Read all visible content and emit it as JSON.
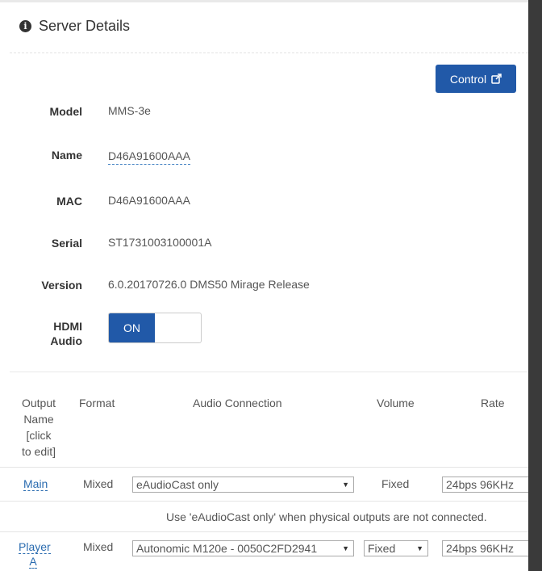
{
  "dialog": {
    "title": "Server Details",
    "control_label": "Control"
  },
  "details": {
    "model_label": "Model",
    "model_value": "MMS-3e",
    "name_label": "Name",
    "name_value": "D46A91600AAA",
    "mac_label": "MAC",
    "mac_value": "D46A91600AAA",
    "serial_label": "Serial",
    "serial_value": "ST1731003100001A",
    "version_label": "Version",
    "version_value": "6.0.20170726.0 DMS50 Mirage Release",
    "hdmi_label_line1": "HDMI",
    "hdmi_label_line2": "Audio",
    "hdmi_toggle": "ON"
  },
  "table": {
    "headers": {
      "output_name": [
        "Output",
        "Name",
        "[click",
        "to edit]"
      ],
      "format": "Format",
      "audio_connection": "Audio Connection",
      "volume": "Volume",
      "rate": "Rate"
    },
    "rows": [
      {
        "name": "Main",
        "format": "Mixed",
        "audio_connection": "eAudioCast only",
        "volume": "Fixed",
        "rate": "24bps 96KHz"
      },
      {
        "name_line1": "Player",
        "name_line2": "A",
        "format": "Mixed",
        "audio_connection": "Autonomic M120e - 0050C2FD2941",
        "volume": "Fixed",
        "rate": "24bps 96KHz"
      }
    ],
    "hint": "Use 'eAudioCast only' when physical outputs are not connected."
  },
  "icons": {
    "info": "info-circle-icon",
    "external": "external-link-icon",
    "dropdown": "caret-down-icon"
  },
  "colors": {
    "primary": "#2159a8",
    "link": "#2b6cb0"
  }
}
